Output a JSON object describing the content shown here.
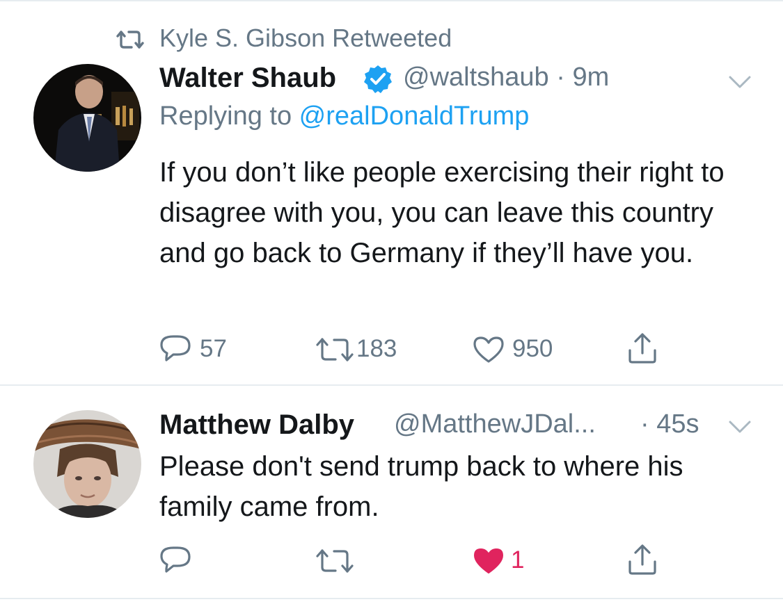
{
  "retweet_context": {
    "text": "Kyle S. Gibson Retweeted"
  },
  "tweets": [
    {
      "name": "Walter Shaub",
      "verified": true,
      "handle_time": "@waltshaub · 9m",
      "replying_prefix": "Replying to ",
      "replying_mention": "@realDonaldTrump",
      "text": "If you don’t like people exercising their right to disagree with you, you can leave this country and go back to Germany if they’ll have you.",
      "actions": {
        "replies": "57",
        "retweets": "183",
        "likes": "950",
        "liked": false
      }
    },
    {
      "name": "Matthew Dalby",
      "verified": false,
      "handle": "@MatthewJDal...",
      "time": "· 45s",
      "text": "Please don't send trump back to where his family came from.",
      "actions": {
        "replies": "",
        "retweets": "",
        "likes": "1",
        "liked": true
      }
    }
  ],
  "colors": {
    "text": "#14171a",
    "secondary": "#657786",
    "link": "#1da1f2",
    "like": "#e0245e",
    "divider": "#e6ecf0"
  }
}
